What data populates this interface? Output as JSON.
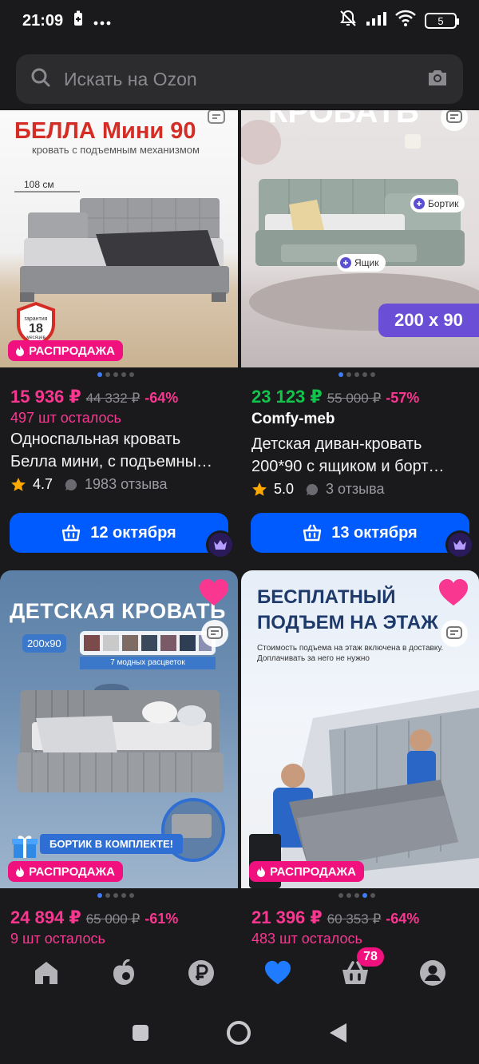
{
  "status_bar": {
    "time": "21:09",
    "battery": "5"
  },
  "search": {
    "placeholder": "Искать на Ozon"
  },
  "colors": {
    "accent": "#005bff",
    "sale": "#f1117e",
    "pink_price": "#f93790",
    "green_price": "#10c44c"
  },
  "products": [
    {
      "banner_title": "БЕЛЛА Мини 90",
      "banner_subtitle": "кровать с подъемным механизмом",
      "size_label": "108 см",
      "guarantee_top": "гарантия",
      "guarantee_num": "18",
      "guarantee_bottom": "месяцев",
      "sale_badge": "РАСПРОДАЖА",
      "price": "15 936 ₽",
      "old_price": "44 332 ₽",
      "discount": "-64%",
      "stock": "497 шт осталось",
      "title_line1": "Односпальная кровать",
      "title_line2": "Белла мини, с подъемны…",
      "rating": "4.7",
      "reviews": "1983 отзыва",
      "delivery_button": "12 октября"
    },
    {
      "banner_title": "КРОВАТЬ",
      "tag_side": "Бортик",
      "tag_box": "Ящик",
      "size_badge": "200 x 90",
      "price": "23 123 ₽",
      "old_price": "55 000 ₽",
      "discount": "-57%",
      "seller": "Comfy-meb",
      "title_line1": "Детская диван-кровать",
      "title_line2": "200*90 с ящиком и борт…",
      "rating": "5.0",
      "reviews": "3 отзыва",
      "delivery_button": "13 октября"
    },
    {
      "banner_title": "ДЕТСКАЯ КРОВАТЬ",
      "size_chip": "200x90",
      "colors_caption": "7 модных расцветок",
      "side_caption": "БОРТИК В КОМПЛЕКТЕ!",
      "sale_badge": "РАСПРОДАЖА",
      "price": "24 894 ₽",
      "old_price": "65 000 ₽",
      "discount": "-61%",
      "stock": "9 шт осталось"
    },
    {
      "banner_title_line1": "БЕСПЛАТНЫЙ",
      "banner_title_line2": "ПОДЪЕМ НА ЭТАЖ",
      "banner_note_line1": "Стоимость подъема на этаж включена в доставку.",
      "banner_note_line2": "Доплачивать за него не нужно",
      "sale_badge": "РАСПРОДАЖА",
      "price": "21 396 ₽",
      "old_price": "60 353 ₽",
      "discount": "-64%",
      "stock": "483 шт осталось"
    }
  ],
  "bottom_nav": {
    "cart_badge": "78"
  }
}
